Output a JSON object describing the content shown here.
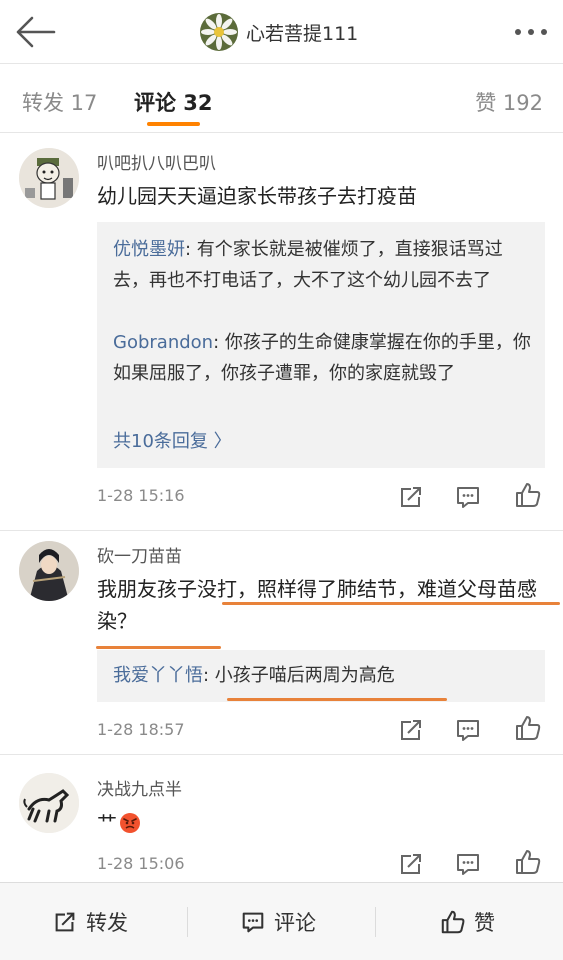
{
  "header": {
    "title": "心若菩提111",
    "back_icon": "arrow-left-icon",
    "more_icon": "more-dots-icon"
  },
  "tabs": {
    "repost": "转发 17",
    "comments": "评论 32",
    "likes": "赞 192",
    "accent_color": "#ff8200"
  },
  "comments": [
    {
      "username": "叭吧扒八叭巴叭",
      "text": "幼儿园天天逼迫家长带孩子去打疫苗",
      "replies": [
        {
          "name": "优悦墨妍",
          "text": ": 有个家长就是被催烦了，直接狠话骂过去，再也不打电话了，大不了这个幼儿园不去了"
        },
        {
          "name": "Gobrandon",
          "text": ": 你孩子的生命健康掌握在你的手里，你如果屈服了，你孩子遭罪，你的家庭就毁了"
        }
      ],
      "more_replies": "共10条回复 〉",
      "time": "1-28 15:16"
    },
    {
      "username": "砍一刀苗苗",
      "text": "我朋友孩子没打，照样得了肺结节，难道父母苗感染？",
      "replies": [
        {
          "name": "我爱丫丫悟",
          "text": ": 小孩子喵后两周为高危"
        }
      ],
      "time": "1-28 18:57"
    },
    {
      "username": "决战九点半",
      "text": "艹",
      "emoji": "angry-face-emoji",
      "time": "1-28 15:06"
    }
  ],
  "bottom_bar": {
    "repost": "转发",
    "comment": "评论",
    "like": "赞"
  },
  "colors": {
    "link": "#4a6c9a",
    "highlight_underline": "#e8823a"
  }
}
